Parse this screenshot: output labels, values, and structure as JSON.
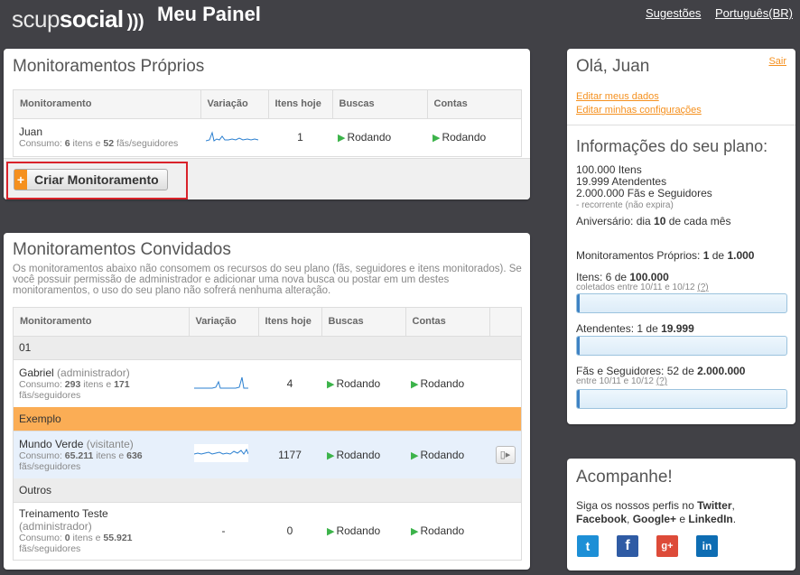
{
  "header": {
    "logo_light": "scup",
    "logo_bold": "social",
    "logo_waves": ")))",
    "title": "Meu Painel",
    "suggestions": "Sugestões",
    "language": "Português(BR)"
  },
  "own": {
    "title": "Monitoramentos Próprios",
    "columns": [
      "Monitoramento",
      "Variação",
      "Itens hoje",
      "Buscas",
      "Contas"
    ],
    "rows": [
      {
        "name": "Juan",
        "usage_pre": "Consumo: ",
        "items": "6",
        "usage_mid": " itens e ",
        "fans": "52",
        "usage_post": " fãs/seguidores",
        "today": "1",
        "searches": "Rodando",
        "accounts": "Rodando"
      }
    ],
    "create_button": "Criar Monitoramento",
    "create_plus": "+"
  },
  "invited": {
    "title": "Monitoramentos Convidados",
    "description": "Os monitoramentos abaixo não consomem os recursos do seu plano (fãs, seguidores e itens monitorados). Se você possuir permissão de administrador e adicionar uma nova busca ou postar em um destes monitoramentos, o uso do seu plano não sofrerá nenhuma alteração.",
    "columns": [
      "Monitoramento",
      "Variação",
      "Itens hoje",
      "Buscas",
      "Contas"
    ],
    "groups": [
      {
        "label": "01"
      },
      {
        "label": "Exemplo"
      },
      {
        "label": "Outros"
      }
    ],
    "rows": [
      {
        "name": "Gabriel",
        "role": "(administrador)",
        "items": "293",
        "fans": "171",
        "today": "4",
        "searches": "Rodando",
        "accounts": "Rodando"
      },
      {
        "name": "Mundo Verde",
        "role": "(visitante)",
        "items": "65.211",
        "fans": "636",
        "today": "1177",
        "searches": "Rodando",
        "accounts": "Rodando"
      },
      {
        "name": "Treinamento Teste",
        "role": "(administrador)",
        "items": "0",
        "fans": "55.921",
        "today": "0",
        "variation": "-",
        "searches": "Rodando",
        "accounts": "Rodando"
      }
    ],
    "usage_pre": "Consumo: ",
    "usage_mid": " itens e ",
    "usage_post": " fãs/seguidores"
  },
  "user": {
    "greeting": "Olá, Juan",
    "logout": "Sair",
    "edit_data": "Editar meus dados",
    "edit_settings": "Editar minhas configurações"
  },
  "plan": {
    "title": "Informações do seu plano:",
    "items_line": "100.000 Itens",
    "agents_line": "19.999 Atendentes",
    "fans_line": "2.000.000 Fãs e Seguidores",
    "recurring": "- recorrente (não expira)",
    "anniversary_pre": "Aniversário: dia ",
    "anniversary_day": "10",
    "anniversary_post": " de cada mês",
    "own_mon_pre": "Monitoramentos Próprios: ",
    "own_mon_used": "1",
    "own_mon_mid": " de ",
    "own_mon_total": "1.000",
    "items_pre": "Itens: 6 de ",
    "items_total": "100.000",
    "items_period": "coletados entre 10/11 e 10/12",
    "help": "(?)",
    "agents_pre": "Atendentes: 1 de ",
    "agents_total": "19.999",
    "fans_pre": "Fãs e Seguidores: 52 de ",
    "fans_total": "2.000.000",
    "fans_period": "entre 10/11 e 10/12",
    "progress": {
      "items": 6e-05,
      "agents": 5e-05,
      "fans": 2.6e-05
    }
  },
  "follow": {
    "title": "Acompanhe!",
    "text_pre": "Siga os nossos perfis no ",
    "twitter": "Twitter",
    "comma": ",",
    "facebook": "Facebook",
    "googleplus": "Google+",
    "and": " e ",
    "linkedin": "LinkedIn",
    "period": ".",
    "icons": [
      "twitter-icon",
      "facebook-icon",
      "google-plus-icon",
      "linkedin-icon"
    ],
    "icon_glyphs": {
      "twitter": "t",
      "facebook": "f",
      "googleplus": "g+",
      "linkedin": "in"
    },
    "colors": {
      "twitter": "#1d8fd6",
      "facebook": "#2f5ba4",
      "googleplus": "#dd4b39",
      "linkedin": "#0e6db3"
    }
  },
  "colors": {
    "accent": "#f5901e",
    "running": "#3cb34a",
    "background": "#414146",
    "highlight": "#d9222a"
  }
}
